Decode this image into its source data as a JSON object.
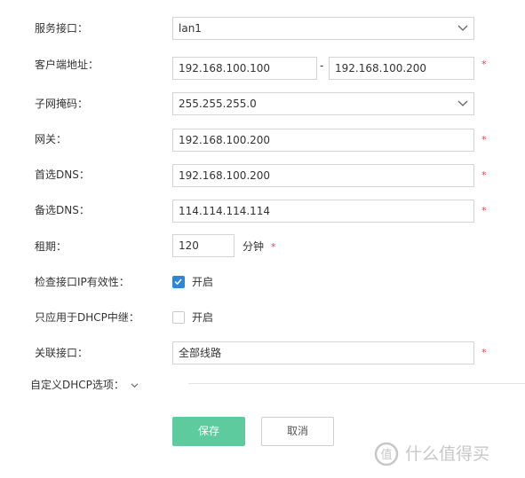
{
  "labels": {
    "service_interface": "服务接口：",
    "client_address": "客户端地址：",
    "subnet_mask": "子网掩码：",
    "gateway": "网关：",
    "preferred_dns": "首选DNS：",
    "alternate_dns": "备选DNS：",
    "lease": "租期：",
    "check_ip": "检查接口IP有效性：",
    "dhcp_relay_only": "只应用于DHCP中继：",
    "linked_interface": "关联接口："
  },
  "values": {
    "service_interface": "lan1",
    "client_address_start": "192.168.100.100",
    "client_address_end": "192.168.100.200",
    "subnet_mask": "255.255.255.0",
    "gateway": "192.168.100.200",
    "preferred_dns": "192.168.100.200",
    "alternate_dns": "114.114.114.114",
    "lease": "120",
    "linked_interface": "全部线路"
  },
  "range_separator": "-",
  "required_mark": "*",
  "lease_unit": "分钟",
  "check_ip": {
    "label": "开启",
    "checked": true
  },
  "dhcp_relay_only": {
    "label": "开启",
    "checked": false
  },
  "advanced_toggle": "自定义DHCP选项：",
  "buttons": {
    "save": "保存",
    "cancel": "取消"
  },
  "watermark": "什么值得买",
  "colors": {
    "primary": "#5ecb9e",
    "checkbox": "#2f86d4",
    "required": "#e6474a"
  },
  "icons": {
    "select_arrow": "chevron-down-icon",
    "watermark_logo": "smzdm-logo-icon"
  }
}
